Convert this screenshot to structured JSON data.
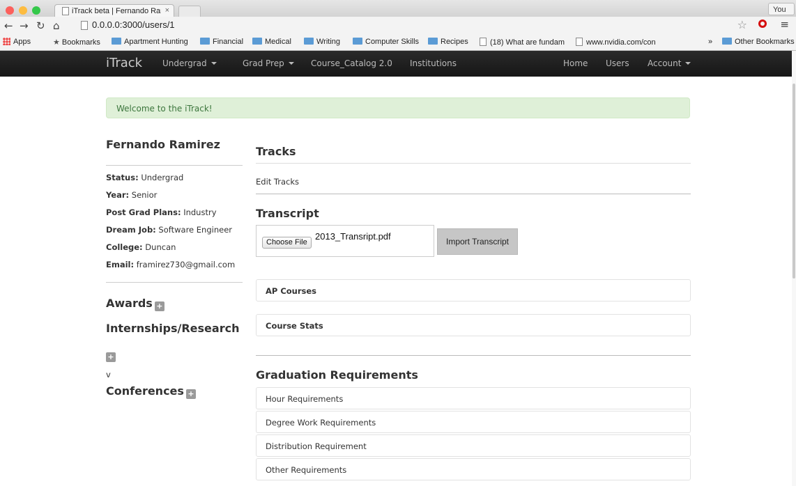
{
  "browser": {
    "tab_title": "iTrack beta | Fernando Ram",
    "tab_close": "×",
    "url": "0.0.0.0:3000/users/1",
    "profile_label": "You",
    "profile_warning": "⚠",
    "bookmarks": [
      {
        "label": "Apps",
        "icon": "apps-grid-icon"
      },
      {
        "label": "Bookmarks",
        "icon": "star-icon"
      },
      {
        "label": "Apartment Hunting",
        "icon": "folder-icon"
      },
      {
        "label": "Financial",
        "icon": "folder-icon"
      },
      {
        "label": "Medical",
        "icon": "folder-icon"
      },
      {
        "label": "Writing",
        "icon": "folder-icon"
      },
      {
        "label": "Computer Skills",
        "icon": "folder-icon"
      },
      {
        "label": "Recipes",
        "icon": "folder-icon"
      },
      {
        "label": "(18) What are fundam",
        "icon": "page-icon"
      },
      {
        "label": "www.nvidia.com/con",
        "icon": "page-icon"
      }
    ],
    "more_bookmarks": "»",
    "other_bookmarks": "Other Bookmarks"
  },
  "appnav": {
    "brand": "iTrack",
    "left_items": [
      "Undergrad",
      "Grad Prep",
      "Course_Catalog 2.0",
      "Institutions"
    ],
    "right_items": [
      "Home",
      "Users",
      "Account"
    ]
  },
  "alert": "Welcome to the iTrack!",
  "profile": {
    "name": "Fernando Ramirez",
    "fields": [
      {
        "label": "Status:",
        "value": " Undergrad"
      },
      {
        "label": "Year:",
        "value": " Senior"
      },
      {
        "label": "Post Grad Plans:",
        "value": " Industry"
      },
      {
        "label": "Dream Job:",
        "value": " Software Engineer"
      },
      {
        "label": "College:",
        "value": " Duncan"
      },
      {
        "label": "Email:",
        "value": " framirez730@gmail.com"
      }
    ],
    "awards": "Awards",
    "internships": "Internships/Research",
    "stray_v": "v",
    "conferences": "Conferences",
    "plus": "+"
  },
  "main": {
    "tracks_heading": "Tracks",
    "edit_tracks": "Edit Tracks",
    "transcript_heading": "Transcript",
    "choose_file": "Choose File",
    "file_name": "2013_Transript.pdf",
    "import_button": "Import Transcript",
    "ap_courses": "AP Courses",
    "course_stats": "Course Stats",
    "grad_heading": "Graduation Requirements",
    "requirements": [
      "Hour Requirements",
      "Degree Work Requirements",
      "Distribution Requirement",
      "Other Requirements"
    ]
  }
}
